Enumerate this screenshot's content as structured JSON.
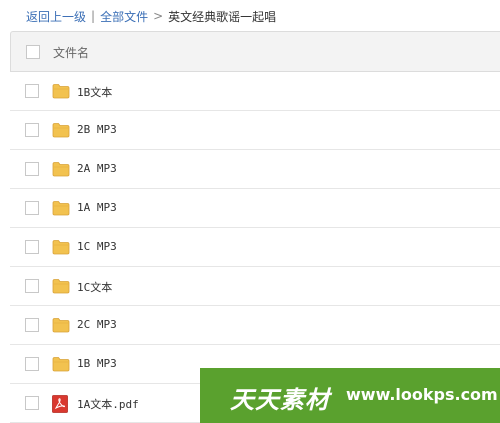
{
  "breadcrumb": {
    "back": "返回上一级",
    "divider": "|",
    "all_files": "全部文件",
    "arrow": ">",
    "current": "英文经典歌谣一起唱"
  },
  "table": {
    "header_label": "文件名"
  },
  "files": [
    {
      "name": "1B文本",
      "type": "folder"
    },
    {
      "name": "2B MP3",
      "type": "folder"
    },
    {
      "name": "2A MP3",
      "type": "folder"
    },
    {
      "name": "1A MP3",
      "type": "folder"
    },
    {
      "name": "1C MP3",
      "type": "folder"
    },
    {
      "name": "1C文本",
      "type": "folder"
    },
    {
      "name": "2C MP3",
      "type": "folder"
    },
    {
      "name": "1B MP3",
      "type": "folder"
    },
    {
      "name": "1A文本.pdf",
      "type": "pdf"
    }
  ],
  "watermark": {
    "brand": "天天素材",
    "url": "www.lookps.com"
  },
  "colors": {
    "link": "#3b6fb6",
    "folder": "#f2c24f",
    "pdf": "#d9382f",
    "watermark_bg": "#5aa12e"
  }
}
